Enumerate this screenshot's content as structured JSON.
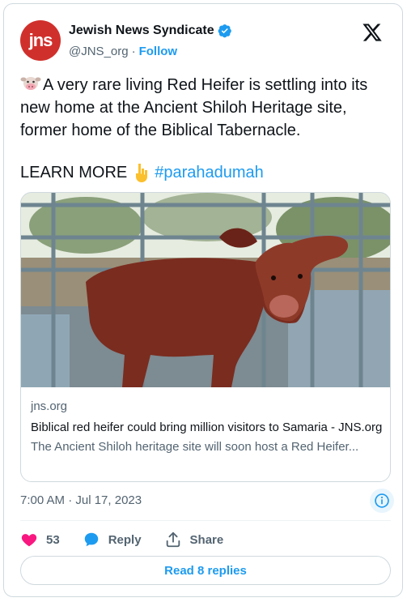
{
  "author": {
    "avatar_text": "jns",
    "display_name": "Jewish News Syndicate",
    "handle": "@JNS_org",
    "separator": "·",
    "follow_label": "Follow"
  },
  "tweet": {
    "text": "A very rare living Red Heifer is settling into its new home at the Ancient Shiloh Heritage site, former home of the Biblical Tabernacle.",
    "learn_more": "LEARN MORE",
    "hashtag": "#parahadumah"
  },
  "link_card": {
    "domain": "jns.org",
    "title": "Biblical red heifer could bring million visitors to Samaria - JNS.org",
    "description": "The Ancient Shiloh heritage site will soon host a Red Heifer..."
  },
  "timestamp": "7:00 AM · Jul 17, 2023",
  "actions": {
    "like_count": "53",
    "reply_label": "Reply",
    "share_label": "Share"
  },
  "read_replies_label": "Read 8 replies",
  "colors": {
    "accent": "#1d9bf0",
    "like": "#f91880",
    "avatar_bg": "#d0302c"
  }
}
